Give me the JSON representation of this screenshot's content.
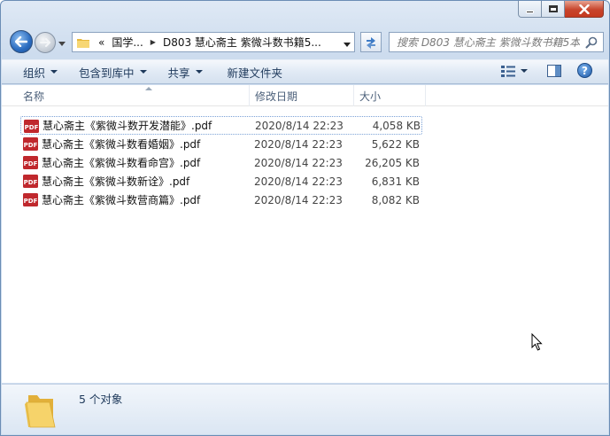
{
  "breadcrumb": {
    "overflow": "«",
    "part1": "国学...",
    "separator": "▶",
    "part2": "D803 慧心斋主 紫微斗数书籍5..."
  },
  "search": {
    "placeholder": "搜索 D803 慧心斋主 紫微斗数书籍5本"
  },
  "toolbar": {
    "organize": "组织",
    "include_in_library": "包含到库中",
    "share": "共享",
    "new_folder": "新建文件夹",
    "help": "?"
  },
  "columns": {
    "name": "名称",
    "date": "修改日期",
    "size": "大小"
  },
  "files": [
    {
      "name": "慧心斋主《紫微斗数开发潜能》.pdf",
      "date": "2020/8/14 22:23",
      "size": "4,058 KB"
    },
    {
      "name": "慧心斋主《紫微斗数看婚姻》.pdf",
      "date": "2020/8/14 22:23",
      "size": "5,622 KB"
    },
    {
      "name": "慧心斋主《紫微斗数看命宫》.pdf",
      "date": "2020/8/14 22:23",
      "size": "26,205 KB"
    },
    {
      "name": "慧心斋主《紫微斗数新诠》.pdf",
      "date": "2020/8/14 22:23",
      "size": "6,831 KB"
    },
    {
      "name": "慧心斋主《紫微斗数营商篇》.pdf",
      "date": "2020/8/14 22:23",
      "size": "8,082 KB"
    }
  ],
  "status": {
    "count": "5 个对象"
  },
  "colors": {
    "accent": "#1e395b",
    "pdf_red": "#c0282d",
    "folder_yellow": "#f2cf5b"
  }
}
